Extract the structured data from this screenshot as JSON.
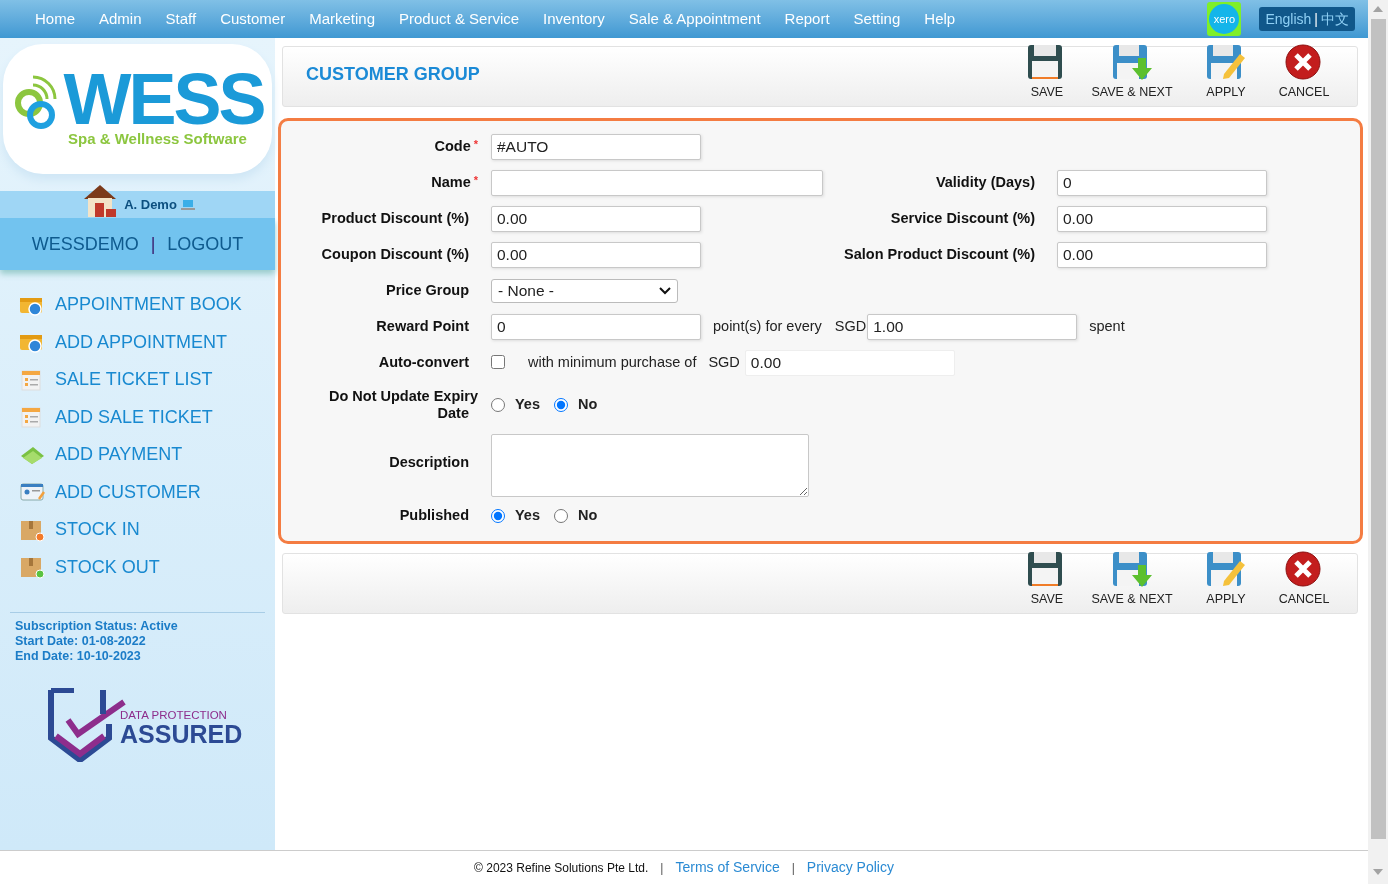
{
  "nav": {
    "items": [
      "Home",
      "Admin",
      "Staff",
      "Customer",
      "Marketing",
      "Product & Service",
      "Inventory",
      "Sale & Appointment",
      "Report",
      "Setting",
      "Help"
    ],
    "xero": "xero",
    "language": {
      "english": "English",
      "separator": "|",
      "chinese": "中文"
    }
  },
  "sidebar": {
    "logo": {
      "title": "WESS",
      "subtitle": "Spa & Wellness Software"
    },
    "user": "A. Demo",
    "account": "WESSDEMO",
    "separator": "|",
    "logout": "LOGOUT",
    "menu": [
      {
        "label": "APPOINTMENT BOOK",
        "kind": "appointment"
      },
      {
        "label": "ADD APPOINTMENT",
        "kind": "appointment"
      },
      {
        "label": "SALE TICKET LIST",
        "kind": "ticket"
      },
      {
        "label": "ADD SALE TICKET",
        "kind": "ticket"
      },
      {
        "label": "ADD PAYMENT",
        "kind": "payment"
      },
      {
        "label": "ADD CUSTOMER",
        "kind": "customer"
      },
      {
        "label": "STOCK IN",
        "kind": "stock-in"
      },
      {
        "label": "STOCK OUT",
        "kind": "stock-out"
      }
    ],
    "subscription": [
      "Subscription Status: Active",
      "Start Date: 01-08-2022",
      "End Date: 10-10-2023"
    ],
    "badge": {
      "top": "DATA PROTECTION",
      "bottom": "ASSURED"
    }
  },
  "title": "CUSTOMER GROUP",
  "toolbar_top": [
    {
      "label": "SAVE",
      "kind": "save"
    },
    {
      "label": "SAVE & NEXT",
      "kind": "save-next"
    },
    {
      "label": "APPLY",
      "kind": "apply"
    },
    {
      "label": "CANCEL",
      "kind": "cancel"
    }
  ],
  "form": {
    "code": {
      "label": "Code",
      "required_mark": "*",
      "value": "#AUTO"
    },
    "name": {
      "label": "Name",
      "required_mark": "*"
    },
    "validity": {
      "label": "Validity (Days)",
      "value": "0"
    },
    "product_discount": {
      "label": "Product Discount (%)",
      "value": "0.00"
    },
    "service_discount": {
      "label": "Service Discount (%)",
      "value": "0.00"
    },
    "coupon_discount": {
      "label": "Coupon Discount (%)",
      "value": "0.00"
    },
    "salon_product_discount": {
      "label": "Salon Product Discount (%)",
      "value": "0.00"
    },
    "price_group": {
      "label": "Price Group",
      "value": "- None -"
    },
    "reward_point": {
      "label": "Reward Point",
      "value": "0",
      "for_every": "point(s) for every",
      "currency": "SGD",
      "amount": "1.00",
      "suffix": "spent"
    },
    "auto_convert": {
      "label": "Auto-convert",
      "checked": false,
      "text": "with minimum purchase of",
      "currency": "SGD",
      "amount": "0.00"
    },
    "expiry": {
      "label": "Do Not Update Expiry Date",
      "options": [
        {
          "label": "Yes",
          "selected": false
        },
        {
          "label": "No",
          "selected": true
        }
      ]
    },
    "description": {
      "label": "Description"
    },
    "published": {
      "label": "Published",
      "options": [
        {
          "label": "Yes",
          "selected": true
        },
        {
          "label": "No",
          "selected": false
        }
      ]
    }
  },
  "toolbar_bottom": [
    {
      "label": "SAVE",
      "kind": "save"
    },
    {
      "label": "SAVE & NEXT",
      "kind": "save-next"
    },
    {
      "label": "APPLY",
      "kind": "apply"
    },
    {
      "label": "CANCEL",
      "kind": "cancel"
    }
  ],
  "footer": {
    "copyright": "© 2023 Refine Solutions Pte Ltd.",
    "links": [
      "Terms of Service",
      "Privacy Policy"
    ],
    "separator": "|"
  }
}
